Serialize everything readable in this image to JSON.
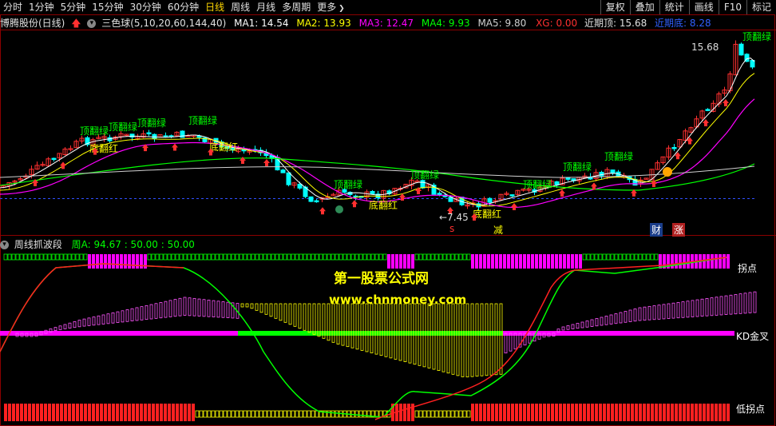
{
  "toolbar": {
    "items": [
      "分时",
      "1分钟",
      "5分钟",
      "15分钟",
      "30分钟",
      "60分钟",
      "日线",
      "周线",
      "月线",
      "多周期",
      "更多"
    ],
    "active_index": 6,
    "right_items": [
      "复权",
      "叠加",
      "统计",
      "画线",
      "F10",
      "标记"
    ]
  },
  "main_header": {
    "stock": "博腾股份(日线)",
    "indicator": "三色球(5,10,20,60,144,40)",
    "ma1": "MA1: 14.54",
    "ma2": "MA2: 13.93",
    "ma3": "MA3: 12.47",
    "ma4": "MA4: 9.93",
    "ma5": "MA5: 9.80",
    "xg": "XG: 0.00",
    "recent_top": "近期顶: 15.68",
    "recent_bottom": "近期底: 8.28"
  },
  "sub_header": {
    "name": "周线抓波段",
    "values": "周A: 94.67  : 50.00  : 50.00"
  },
  "labels": {
    "price_high": "15.68",
    "price_low": "←7.45",
    "top_flip": "顶翻绿",
    "bottom_flip": "底翻红",
    "cai": "财",
    "zhang": "涨",
    "jian": "减",
    "s_mark": "s",
    "inflection": "拐点",
    "kd_cross": "KD金叉",
    "low_inflection": "低拐点"
  },
  "watermark": {
    "line1": "第一股票公式网",
    "line2": "www.chnmoney.com"
  },
  "colors": {
    "up": "#ff3030",
    "down": "#00ffff",
    "ma1": "#ffffff",
    "ma2": "#ffff00",
    "ma3": "#ff00ff",
    "ma4": "#00ff00",
    "ma5": "#d0d0d0",
    "magenta": "#ff00ff",
    "green": "#00ff00"
  }
}
